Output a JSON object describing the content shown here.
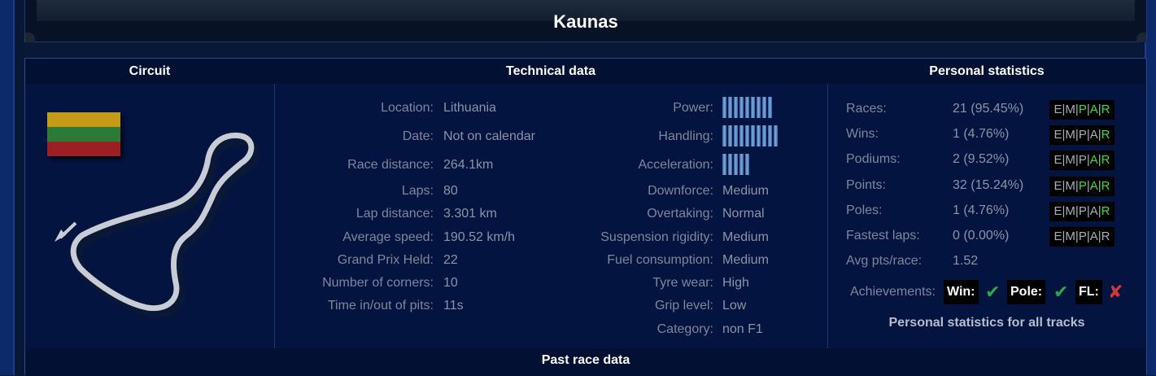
{
  "page": {
    "title": "Kaunas"
  },
  "sections": {
    "circuit": "Circuit",
    "technical": "Technical data",
    "personal": "Personal statistics",
    "past": "Past race data"
  },
  "flag": {
    "country": "Lithuania",
    "colors": [
      "#c59a18",
      "#2c7a35",
      "#9c1f23"
    ]
  },
  "technical_left": [
    {
      "label": "Location:",
      "value": "Lithuania"
    },
    {
      "label": "Date:",
      "value": "Not on calendar"
    },
    {
      "label": "Race distance:",
      "value": "264.1km"
    },
    {
      "label": "Laps:",
      "value": "80"
    },
    {
      "label": "Lap distance:",
      "value": "3.301 km"
    },
    {
      "label": "Average speed:",
      "value": "190.52 km/h"
    },
    {
      "label": "Grand Prix Held:",
      "value": "22"
    },
    {
      "label": "Number of corners:",
      "value": "10"
    },
    {
      "label": "Time in/out of pits:",
      "value": "11s"
    }
  ],
  "technical_right": [
    {
      "label": "Power:",
      "bars": 9
    },
    {
      "label": "Handling:",
      "bars": 10
    },
    {
      "label": "Acceleration:",
      "bars": 5
    },
    {
      "label": "Downforce:",
      "value": "Medium"
    },
    {
      "label": "Overtaking:",
      "value": "Normal"
    },
    {
      "label": "Suspension rigidity:",
      "value": "Medium"
    },
    {
      "label": "Fuel consumption:",
      "value": "Medium"
    },
    {
      "label": "Tyre wear:",
      "value": "High"
    },
    {
      "label": "Grip level:",
      "value": "Low"
    },
    {
      "label": "Category:",
      "value": "non F1"
    }
  ],
  "personal_stats": [
    {
      "label": "Races:",
      "value": "21 (95.45%)",
      "emp": [
        "E",
        "M",
        "P",
        "A",
        "R"
      ],
      "green": [
        2,
        3,
        4
      ]
    },
    {
      "label": "Wins:",
      "value": "1 (4.76%)",
      "emp": [
        "E",
        "M",
        "P",
        "A",
        "R"
      ],
      "green": [
        4
      ]
    },
    {
      "label": "Podiums:",
      "value": "2 (9.52%)",
      "emp": [
        "E",
        "M",
        "P",
        "A",
        "R"
      ],
      "green": [
        3,
        4
      ]
    },
    {
      "label": "Points:",
      "value": "32 (15.24%)",
      "emp": [
        "E",
        "M",
        "P",
        "A",
        "R"
      ],
      "green": [
        2,
        3,
        4
      ]
    },
    {
      "label": "Poles:",
      "value": "1 (4.76%)",
      "emp": [
        "E",
        "M",
        "P",
        "A",
        "R"
      ],
      "green": [
        4
      ]
    },
    {
      "label": "Fastest laps:",
      "value": "0 (0.00%)",
      "emp": [
        "E",
        "M",
        "P",
        "A",
        "R"
      ],
      "green": []
    },
    {
      "label": "Avg pts/race:",
      "value": "1.52"
    }
  ],
  "achievements": {
    "label": "Achievements:",
    "win": {
      "label": "Win:",
      "achieved": true,
      "icon": "check-icon"
    },
    "pole": {
      "label": "Pole:",
      "achieved": true,
      "icon": "check-icon"
    },
    "fl": {
      "label": "FL:",
      "achieved": false,
      "icon": "cross-icon"
    }
  },
  "all_tracks_link": "Personal statistics for all tracks",
  "colors": {
    "green_letter": "#38e038",
    "achieved": "#2fa54a",
    "not_achieved": "#d33838"
  }
}
